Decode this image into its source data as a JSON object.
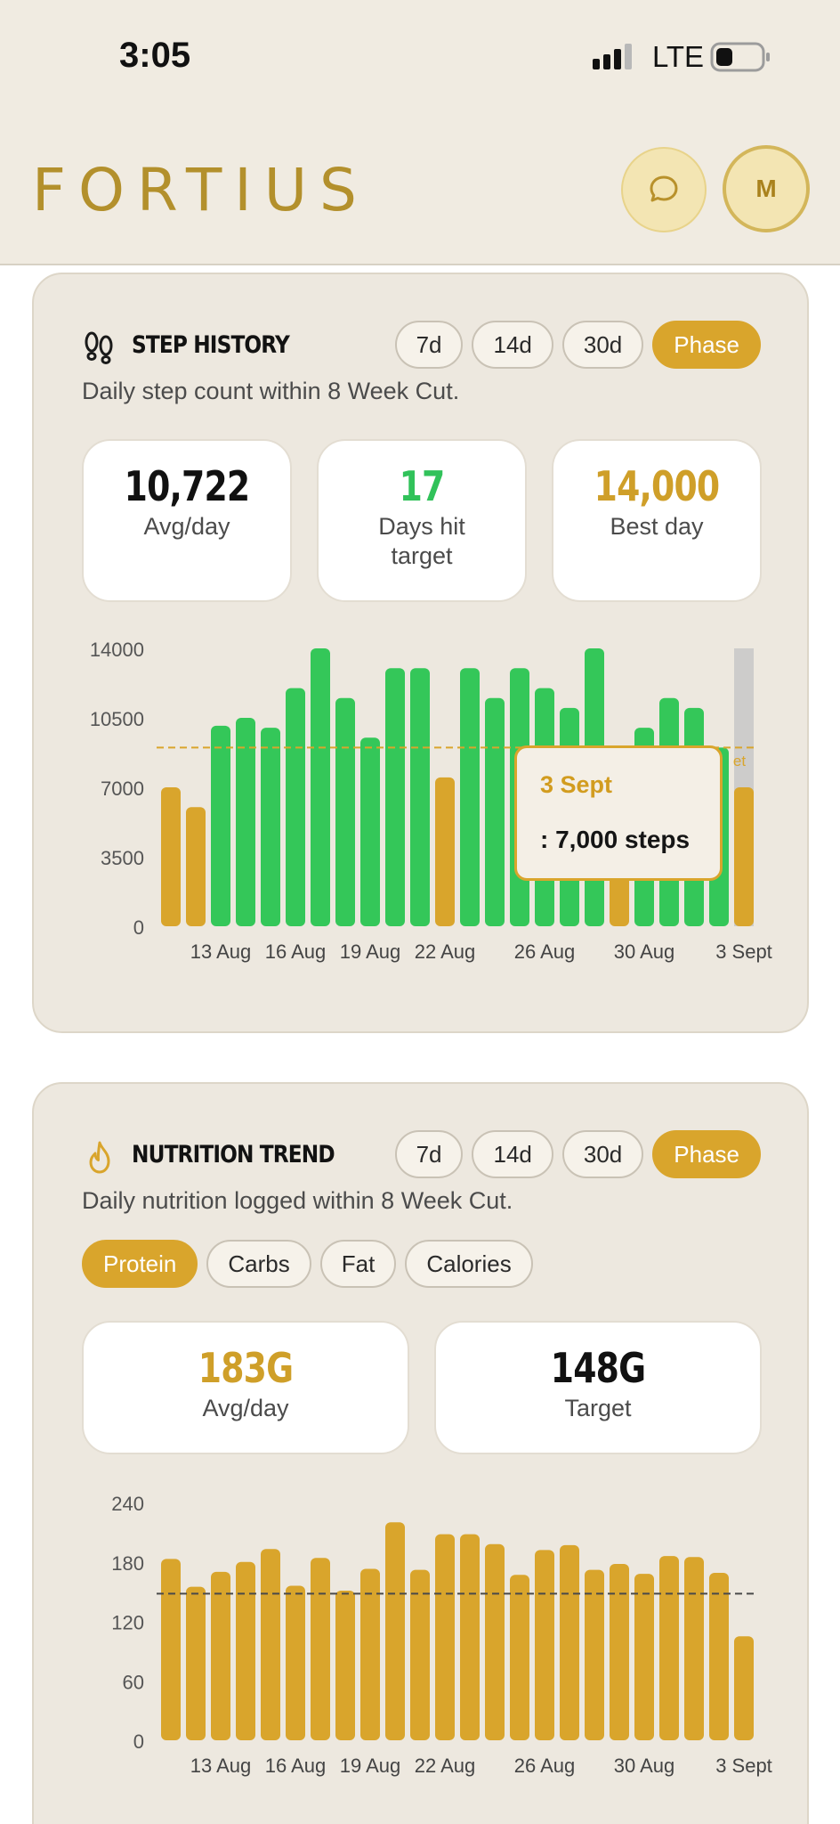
{
  "status_bar": {
    "time": "3:05",
    "network": "LTE"
  },
  "header": {
    "brand": "FORTIUS",
    "avatar_initial": "M"
  },
  "step_history": {
    "title": "STEP HISTORY",
    "ranges": [
      "7d",
      "14d",
      "30d",
      "Phase"
    ],
    "active_range": "Phase",
    "subtitle": "Daily step count within 8 Week Cut.",
    "stats": [
      {
        "value": "10,722",
        "label": "Avg/day",
        "color": "#111111"
      },
      {
        "value": "17",
        "label": "Days hit target",
        "color": "#31c25a"
      },
      {
        "value": "14,000",
        "label": "Best day",
        "color": "#cf9f29"
      }
    ],
    "tooltip": {
      "date": "3 Sept",
      "steps": ": 7,000 steps"
    },
    "target_tag": "et"
  },
  "nutrition_trend": {
    "title": "NUTRITION TREND",
    "ranges": [
      "7d",
      "14d",
      "30d",
      "Phase"
    ],
    "active_range": "Phase",
    "subtitle": "Daily nutrition logged within 8 Week Cut.",
    "metrics": [
      "Protein",
      "Carbs",
      "Fat",
      "Calories"
    ],
    "active_metric": "Protein",
    "stats": [
      {
        "value": "183G",
        "label": "Avg/day",
        "color": "#cf9f29"
      },
      {
        "value": "148G",
        "label": "Target",
        "color": "#111111"
      }
    ]
  },
  "chart_data": [
    {
      "type": "bar",
      "yticks": [
        0,
        3500,
        7000,
        10500,
        14000
      ],
      "ylim": [
        0,
        14000
      ],
      "target": 9000,
      "x_tick_labels": [
        "13 Aug",
        "16 Aug",
        "19 Aug",
        "22 Aug",
        "26 Aug",
        "30 Aug",
        "3 Sept"
      ],
      "x_tick_index": [
        2,
        5,
        8,
        11,
        15,
        19,
        23
      ],
      "values": [
        7000,
        6000,
        10100,
        10500,
        10000,
        12000,
        14000,
        11500,
        9500,
        13000,
        13000,
        7500,
        13000,
        11500,
        13000,
        12000,
        11000,
        14000,
        7000,
        10000,
        11500,
        11000,
        9000,
        7000
      ],
      "colors": [
        "gold",
        "gold",
        "green",
        "green",
        "green",
        "green",
        "green",
        "green",
        "green",
        "green",
        "green",
        "gold",
        "green",
        "green",
        "green",
        "green",
        "green",
        "green",
        "gold",
        "green",
        "green",
        "green",
        "green",
        "gold"
      ],
      "colors_hex": {
        "gold": "#d9a52c",
        "green": "#34c759",
        "grey": "#c9c9c9"
      }
    },
    {
      "type": "bar",
      "yticks": [
        0,
        60,
        120,
        180,
        240
      ],
      "ylim": [
        0,
        240
      ],
      "target": 148,
      "x_tick_labels": [
        "13 Aug",
        "16 Aug",
        "19 Aug",
        "22 Aug",
        "26 Aug",
        "30 Aug",
        "3 Sept"
      ],
      "x_tick_index": [
        2,
        5,
        8,
        11,
        15,
        19,
        23
      ],
      "values": [
        183,
        155,
        170,
        180,
        193,
        156,
        184,
        151,
        173,
        220,
        172,
        208,
        208,
        198,
        167,
        192,
        197,
        172,
        178,
        168,
        186,
        185,
        169,
        105
      ],
      "color": "#d9a52c"
    }
  ]
}
